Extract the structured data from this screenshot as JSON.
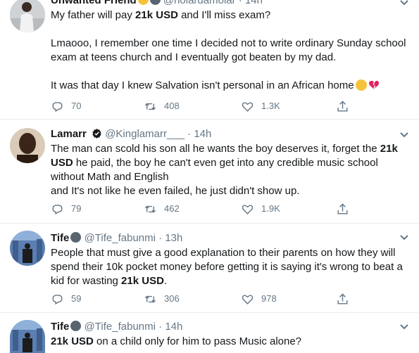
{
  "tweets": [
    {
      "name": "Unwanted Friend",
      "handle": "@holardamolar",
      "dot": "·",
      "time": "14h",
      "lines": [
        {
          "pre": "My father will pay ",
          "bold": "21k USD",
          "post": " and I'll miss exam?"
        },
        {
          "gap": true
        },
        {
          "pre": "Lmaooo, I remember one time I decided not to write ordinary Sunday school",
          "bold": "",
          "post": ""
        },
        {
          "pre": "exam at teens church and I eventually got beaten by my dad.",
          "bold": "",
          "post": ""
        },
        {
          "gap": true
        },
        {
          "pre": "It was that day I knew Salvation isn't personal in an African home",
          "bold": "",
          "post": ""
        }
      ],
      "replies": "70",
      "retweets": "408",
      "likes": "1.3K"
    },
    {
      "name": "Lamarr",
      "handle": "@Kinglamarr___",
      "dot": "·",
      "time": "14h",
      "lines": [
        {
          "pre": "The man can scold his son all he wants the boy deserves it, forget the ",
          "bold": "21k",
          "post": ""
        },
        {
          "pre": "",
          "bold": "USD",
          "post": " he paid, the boy he can't even get into any credible music school"
        },
        {
          "pre": "without Math and English",
          "bold": "",
          "post": ""
        },
        {
          "pre": "and It's not like he even failed, he just didn't show up.",
          "bold": "",
          "post": ""
        }
      ],
      "replies": "79",
      "retweets": "462",
      "likes": "1.9K"
    },
    {
      "name": "Tife",
      "handle": "@Tife_fabunmi",
      "dot": "·",
      "time": "13h",
      "lines": [
        {
          "pre": "People that must give a good explanation to their parents on how they will",
          "bold": "",
          "post": ""
        },
        {
          "pre": "spend their 10k pocket money before getting it is saying it's wrong to beat a",
          "bold": "",
          "post": ""
        },
        {
          "pre": "kid for wasting ",
          "bold": "21k USD",
          "post": "."
        }
      ],
      "replies": "59",
      "retweets": "306",
      "likes": "978"
    },
    {
      "name": "Tife",
      "handle": "@Tife_fabunmi",
      "dot": "·",
      "time": "14h",
      "lines": [
        {
          "pre": "",
          "bold": "21k USD",
          "post": " on a child only for him to pass Music alone?"
        }
      ]
    }
  ],
  "icons": {
    "reply": "reply-icon",
    "retweet": "retweet-icon",
    "like": "like-icon",
    "share": "share-icon",
    "more": "chevron-down-icon",
    "verified": "verified-badge-icon"
  },
  "colors": {
    "text": "#14171a",
    "muted": "#657786",
    "divider": "#e6ecf0",
    "verified": "#14171a"
  }
}
